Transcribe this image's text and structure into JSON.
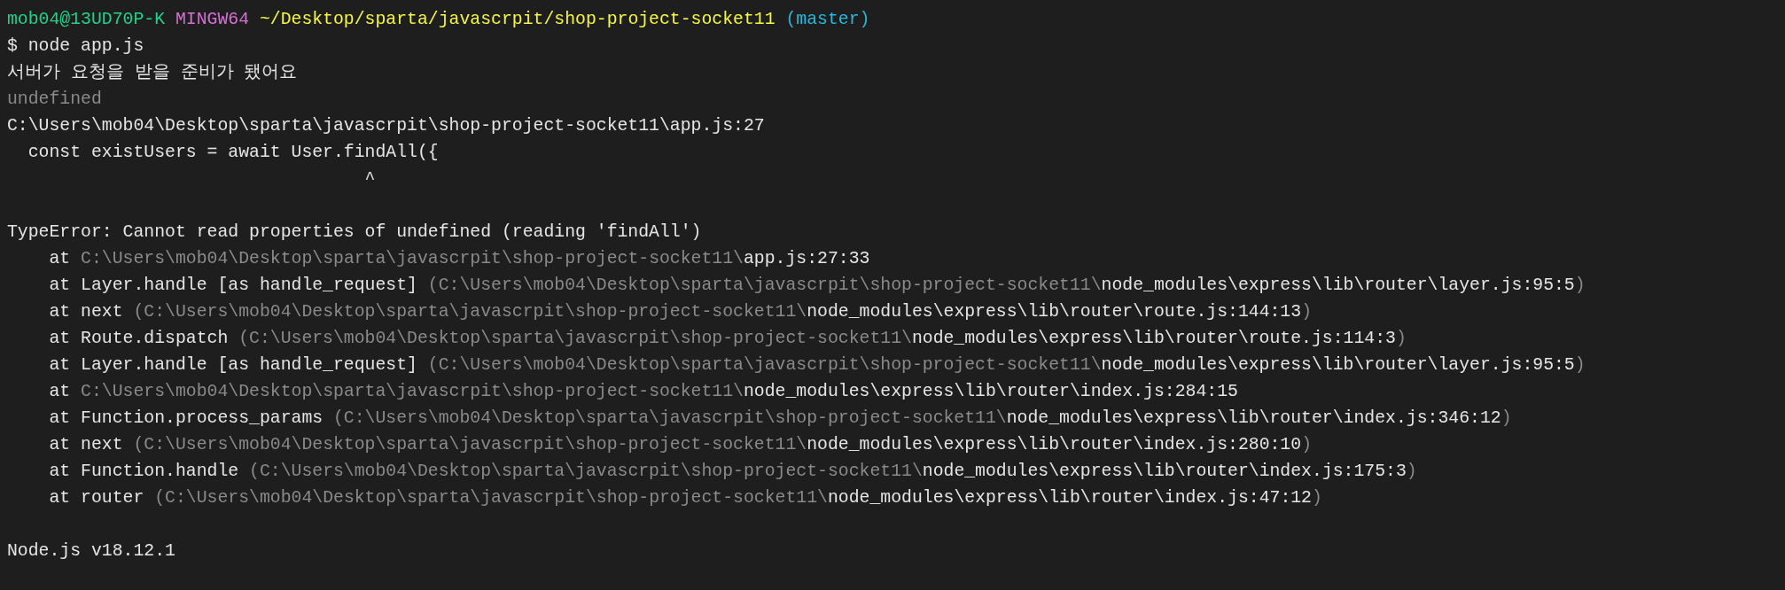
{
  "terminal": {
    "lines": [
      {
        "kind": "text",
        "segments": [
          {
            "kind": "user",
            "text": "mob04@13UD70P-K "
          },
          {
            "kind": "host",
            "text": "MINGW64 "
          },
          {
            "kind": "path",
            "text": "~/Desktop/sparta/javascrpit/shop-project-socket11 "
          },
          {
            "kind": "branch",
            "text": "(master)"
          }
        ]
      },
      {
        "kind": "text",
        "segments": [
          {
            "kind": "plain",
            "text": "$ node app.js"
          }
        ]
      },
      {
        "kind": "text",
        "segments": [
          {
            "kind": "plain",
            "text": "서버가 요청을 받을 준비가 됐어요"
          }
        ]
      },
      {
        "kind": "text",
        "segments": [
          {
            "kind": "dim",
            "text": "undefined"
          }
        ]
      },
      {
        "kind": "text",
        "segments": [
          {
            "kind": "plain",
            "text": "C:\\Users\\mob04\\Desktop\\sparta\\javascrpit\\shop-project-socket11\\app.js:27"
          }
        ]
      },
      {
        "kind": "text",
        "segments": [
          {
            "kind": "plain",
            "text": "  const existUsers = await User.findAll({"
          }
        ]
      },
      {
        "kind": "text",
        "segments": [
          {
            "kind": "plain",
            "text": "                                  ^"
          }
        ]
      },
      {
        "kind": "blank"
      },
      {
        "kind": "text",
        "segments": [
          {
            "kind": "plain",
            "text": "TypeError: Cannot read properties of undefined (reading 'findAll')"
          }
        ]
      },
      {
        "kind": "text",
        "segments": [
          {
            "kind": "plain",
            "text": "    at "
          },
          {
            "kind": "dim",
            "text": "C:\\Users\\mob04\\Desktop\\sparta\\javascrpit\\shop-project-socket11\\"
          },
          {
            "kind": "plain",
            "text": "app.js:27:33"
          }
        ]
      },
      {
        "kind": "text",
        "segments": [
          {
            "kind": "plain",
            "text": "    at Layer.handle [as handle_request] "
          },
          {
            "kind": "dim",
            "text": "(C:\\Users\\mob04\\Desktop\\sparta\\javascrpit\\shop-project-socket11\\"
          },
          {
            "kind": "plain",
            "text": "node_modules\\express\\lib\\router\\layer.js:95:5"
          },
          {
            "kind": "dim",
            "text": ")"
          }
        ]
      },
      {
        "kind": "text",
        "segments": [
          {
            "kind": "plain",
            "text": "    at next "
          },
          {
            "kind": "dim",
            "text": "(C:\\Users\\mob04\\Desktop\\sparta\\javascrpit\\shop-project-socket11\\"
          },
          {
            "kind": "plain",
            "text": "node_modules\\express\\lib\\router\\route.js:144:13"
          },
          {
            "kind": "dim",
            "text": ")"
          }
        ]
      },
      {
        "kind": "text",
        "segments": [
          {
            "kind": "plain",
            "text": "    at Route.dispatch "
          },
          {
            "kind": "dim",
            "text": "(C:\\Users\\mob04\\Desktop\\sparta\\javascrpit\\shop-project-socket11\\"
          },
          {
            "kind": "plain",
            "text": "node_modules\\express\\lib\\router\\route.js:114:3"
          },
          {
            "kind": "dim",
            "text": ")"
          }
        ]
      },
      {
        "kind": "text",
        "segments": [
          {
            "kind": "plain",
            "text": "    at Layer.handle [as handle_request] "
          },
          {
            "kind": "dim",
            "text": "(C:\\Users\\mob04\\Desktop\\sparta\\javascrpit\\shop-project-socket11\\"
          },
          {
            "kind": "plain",
            "text": "node_modules\\express\\lib\\router\\layer.js:95:5"
          },
          {
            "kind": "dim",
            "text": ")"
          }
        ]
      },
      {
        "kind": "text",
        "segments": [
          {
            "kind": "plain",
            "text": "    at "
          },
          {
            "kind": "dim",
            "text": "C:\\Users\\mob04\\Desktop\\sparta\\javascrpit\\shop-project-socket11\\"
          },
          {
            "kind": "plain",
            "text": "node_modules\\express\\lib\\router\\index.js:284:15"
          }
        ]
      },
      {
        "kind": "text",
        "segments": [
          {
            "kind": "plain",
            "text": "    at Function.process_params "
          },
          {
            "kind": "dim",
            "text": "(C:\\Users\\mob04\\Desktop\\sparta\\javascrpit\\shop-project-socket11\\"
          },
          {
            "kind": "plain",
            "text": "node_modules\\express\\lib\\router\\index.js:346:12"
          },
          {
            "kind": "dim",
            "text": ")"
          }
        ]
      },
      {
        "kind": "text",
        "segments": [
          {
            "kind": "plain",
            "text": "    at next "
          },
          {
            "kind": "dim",
            "text": "(C:\\Users\\mob04\\Desktop\\sparta\\javascrpit\\shop-project-socket11\\"
          },
          {
            "kind": "plain",
            "text": "node_modules\\express\\lib\\router\\index.js:280:10"
          },
          {
            "kind": "dim",
            "text": ")"
          }
        ]
      },
      {
        "kind": "text",
        "segments": [
          {
            "kind": "plain",
            "text": "    at Function.handle "
          },
          {
            "kind": "dim",
            "text": "(C:\\Users\\mob04\\Desktop\\sparta\\javascrpit\\shop-project-socket11\\"
          },
          {
            "kind": "plain",
            "text": "node_modules\\express\\lib\\router\\index.js:175:3"
          },
          {
            "kind": "dim",
            "text": ")"
          }
        ]
      },
      {
        "kind": "text",
        "segments": [
          {
            "kind": "plain",
            "text": "    at router "
          },
          {
            "kind": "dim",
            "text": "(C:\\Users\\mob04\\Desktop\\sparta\\javascrpit\\shop-project-socket11\\"
          },
          {
            "kind": "plain",
            "text": "node_modules\\express\\lib\\router\\index.js:47:12"
          },
          {
            "kind": "dim",
            "text": ")"
          }
        ]
      },
      {
        "kind": "blank"
      },
      {
        "kind": "text",
        "segments": [
          {
            "kind": "plain",
            "text": "Node.js v18.12.1"
          }
        ]
      }
    ]
  }
}
